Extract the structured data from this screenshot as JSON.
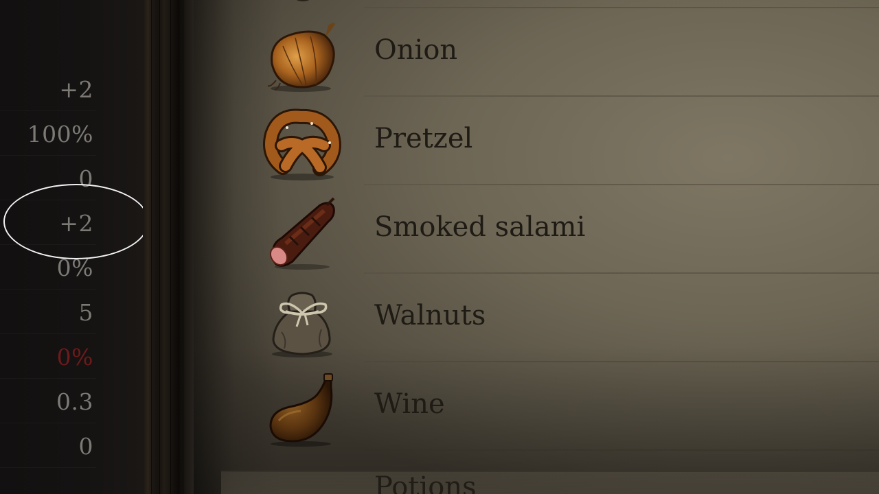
{
  "stats": [
    {
      "value": "+2",
      "negative": false
    },
    {
      "value": "100%",
      "negative": false
    },
    {
      "value": "0",
      "negative": false
    },
    {
      "value": "+2",
      "negative": false,
      "highlighted": true
    },
    {
      "value": "0%",
      "negative": false
    },
    {
      "value": "5",
      "negative": false
    },
    {
      "value": "0%",
      "negative": true
    },
    {
      "value": "0.3",
      "negative": false
    },
    {
      "value": "0",
      "negative": false
    }
  ],
  "items": [
    {
      "name": "Onion",
      "icon": "onion-icon"
    },
    {
      "name": "Pretzel",
      "icon": "pretzel-icon"
    },
    {
      "name": "Smoked salami",
      "icon": "salami-icon"
    },
    {
      "name": "Walnuts",
      "icon": "walnuts-sack-icon"
    },
    {
      "name": "Wine",
      "icon": "wine-flask-icon"
    }
  ],
  "next_item_partial": "Potions",
  "colors": {
    "stat_text": "#7d7a76",
    "stat_negative": "#6e1a1a",
    "item_text": "#1e1a14",
    "parchment": "#7f7764",
    "highlight_ring": "#f2f2f2"
  }
}
